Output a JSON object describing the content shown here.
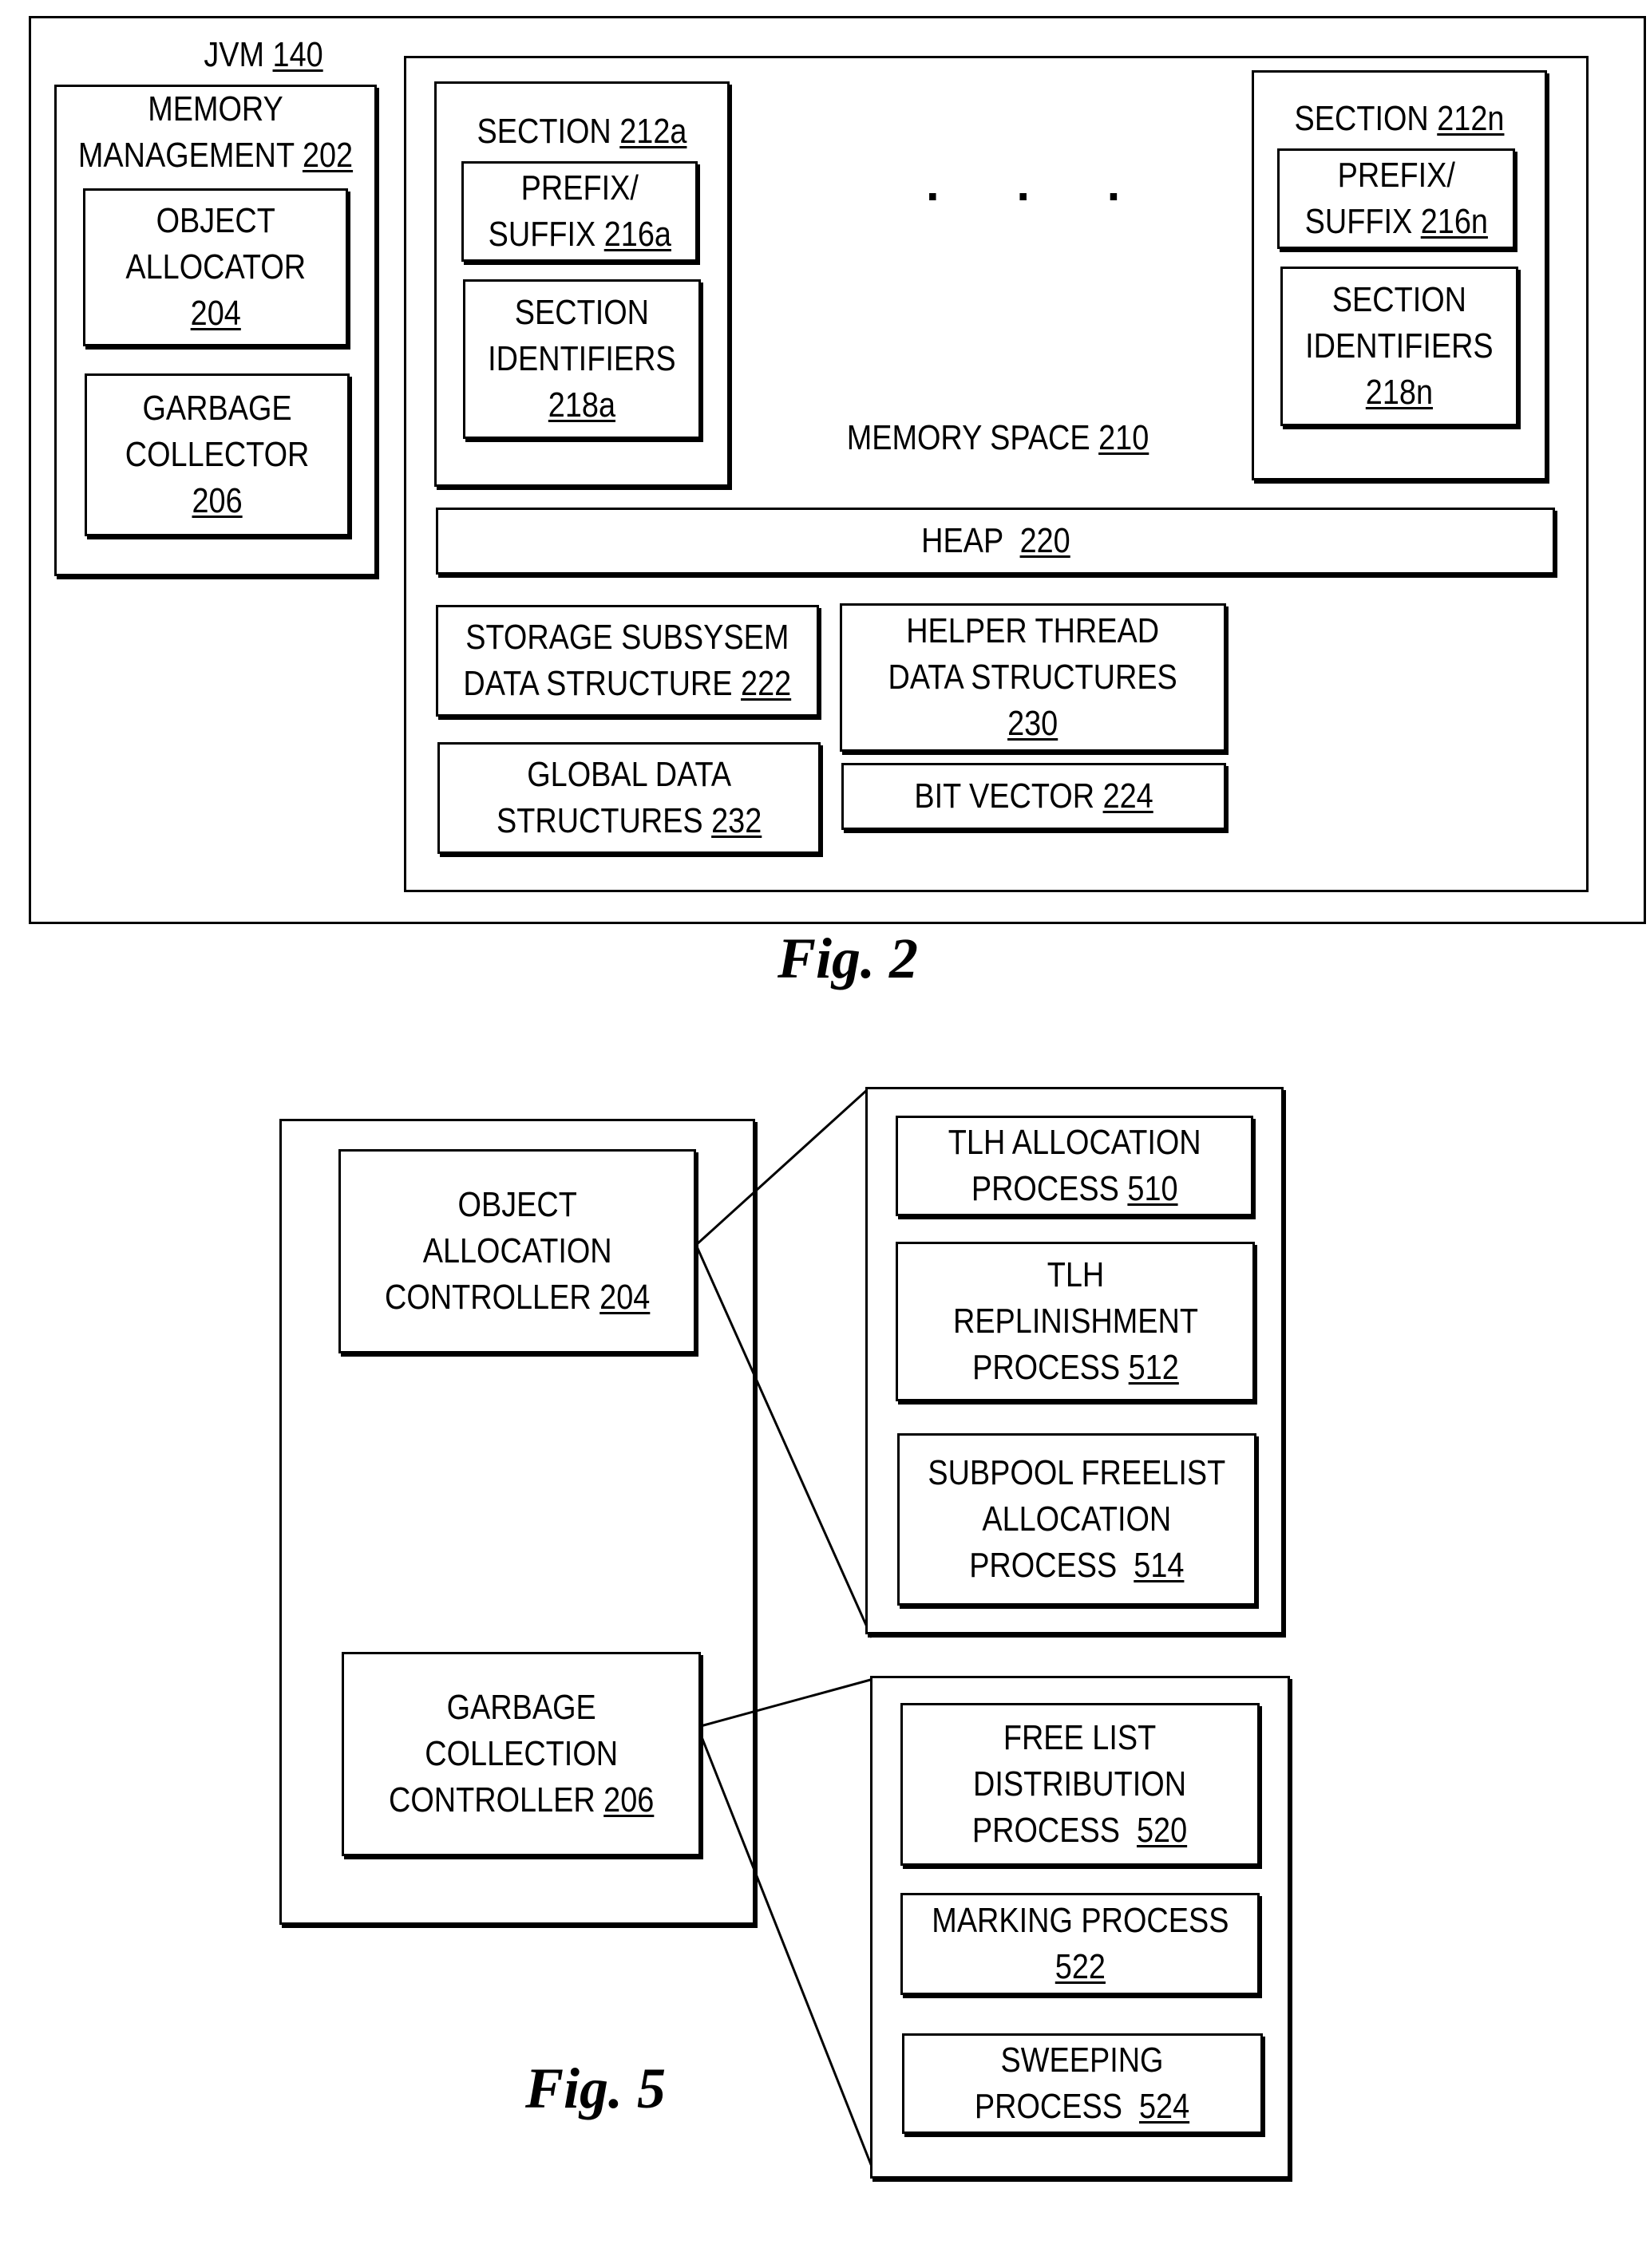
{
  "fig2": {
    "caption": "Fig. 2",
    "jvm": {
      "name": "JVM ",
      "ref": "140"
    },
    "memory_management": {
      "name": "MEMORY MANAGEMENT ",
      "ref": "202",
      "line1": "MEMORY",
      "line2": "MANAGEMENT "
    },
    "object_allocator": {
      "line1": "OBJECT",
      "line2": "ALLOCATOR",
      "ref": "204"
    },
    "garbage_collector": {
      "line1": "GARBAGE",
      "line2": "COLLECTOR",
      "ref": "206"
    },
    "memory_space": {
      "name": "MEMORY SPACE ",
      "ref": "210"
    },
    "ellipsis": ". . .",
    "section_a": {
      "name": "SECTION ",
      "ref": "212a",
      "prefix": {
        "line1": "PREFIX/",
        "line2": "SUFFIX ",
        "ref": "216a"
      },
      "identifiers": {
        "line1": "SECTION",
        "line2": "IDENTIFIERS",
        "ref": "218a"
      }
    },
    "section_n": {
      "name": "SECTION ",
      "ref": "212n",
      "prefix": {
        "line1": "PREFIX/",
        "line2": "SUFFIX ",
        "ref": "216n"
      },
      "identifiers": {
        "line1": "SECTION",
        "line2": "IDENTIFIERS",
        "ref": "218n"
      }
    },
    "heap": {
      "name": "HEAP  ",
      "ref": "220"
    },
    "storage_subsystem": {
      "line1": "STORAGE SUBSYSEM",
      "line2": "DATA STRUCTURE ",
      "ref": "222"
    },
    "helper_thread": {
      "line1": "HELPER THREAD",
      "line2": "DATA STRUCTURES",
      "ref": "230"
    },
    "global_data": {
      "line1": "GLOBAL DATA",
      "line2": "STRUCTURES ",
      "ref": "232"
    },
    "bit_vector": {
      "name": "BIT VECTOR ",
      "ref": "224"
    }
  },
  "fig5": {
    "caption": "Fig. 5",
    "object_allocation_controller": {
      "line1": "OBJECT",
      "line2": "ALLOCATION",
      "line3": "CONTROLLER ",
      "ref": "204"
    },
    "garbage_collection_controller": {
      "line1": "GARBAGE",
      "line2": "COLLECTION",
      "line3": "CONTROLLER ",
      "ref": "206"
    },
    "allocation_processes": [
      {
        "line1": "TLH ALLOCATION",
        "line2": "PROCESS ",
        "ref": "510"
      },
      {
        "line1": "TLH",
        "line2": "REPLINISHMENT",
        "line3": "PROCESS ",
        "ref": "512"
      },
      {
        "line1": "SUBPOOL FREELIST",
        "line2": "ALLOCATION",
        "line3": "PROCESS  ",
        "ref": "514"
      }
    ],
    "gc_processes": [
      {
        "line1": "FREE LIST",
        "line2": "DISTRIBUTION",
        "line3": "PROCESS  ",
        "ref": "520"
      },
      {
        "line1": "MARKING PROCESS",
        "ref": "522"
      },
      {
        "line1": "SWEEPING",
        "line2": "PROCESS  ",
        "ref": "524"
      }
    ]
  }
}
